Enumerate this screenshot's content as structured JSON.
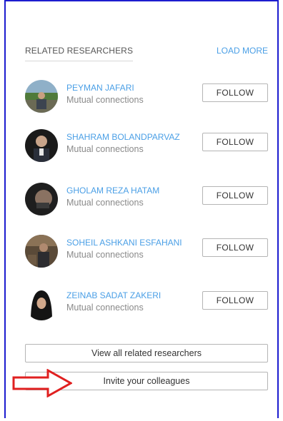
{
  "colors": {
    "frame_border": "#1c1ccf",
    "link": "#4a9fe6",
    "arrow": "#e02020"
  },
  "header": {
    "title": "RELATED RESEARCHERS",
    "load_more": "LOAD MORE"
  },
  "researchers": [
    {
      "name": "PEYMAN JAFARI",
      "subtitle": "Mutual connections",
      "follow_label": "FOLLOW"
    },
    {
      "name": "SHAHRAM BOLANDPARVAZ",
      "subtitle": "Mutual connections",
      "follow_label": "FOLLOW"
    },
    {
      "name": "GHOLAM REZA HATAM",
      "subtitle": "Mutual connections",
      "follow_label": "FOLLOW"
    },
    {
      "name": "SOHEIL ASHKANI ESFAHANI",
      "subtitle": "Mutual connections",
      "follow_label": "FOLLOW"
    },
    {
      "name": "ZEINAB SADAT ZAKERI",
      "subtitle": "Mutual connections",
      "follow_label": "FOLLOW"
    }
  ],
  "actions": {
    "view_all": "View all related researchers",
    "invite": "Invite your colleagues"
  },
  "annotation": {
    "arrow_icon": "right-arrow-icon"
  }
}
